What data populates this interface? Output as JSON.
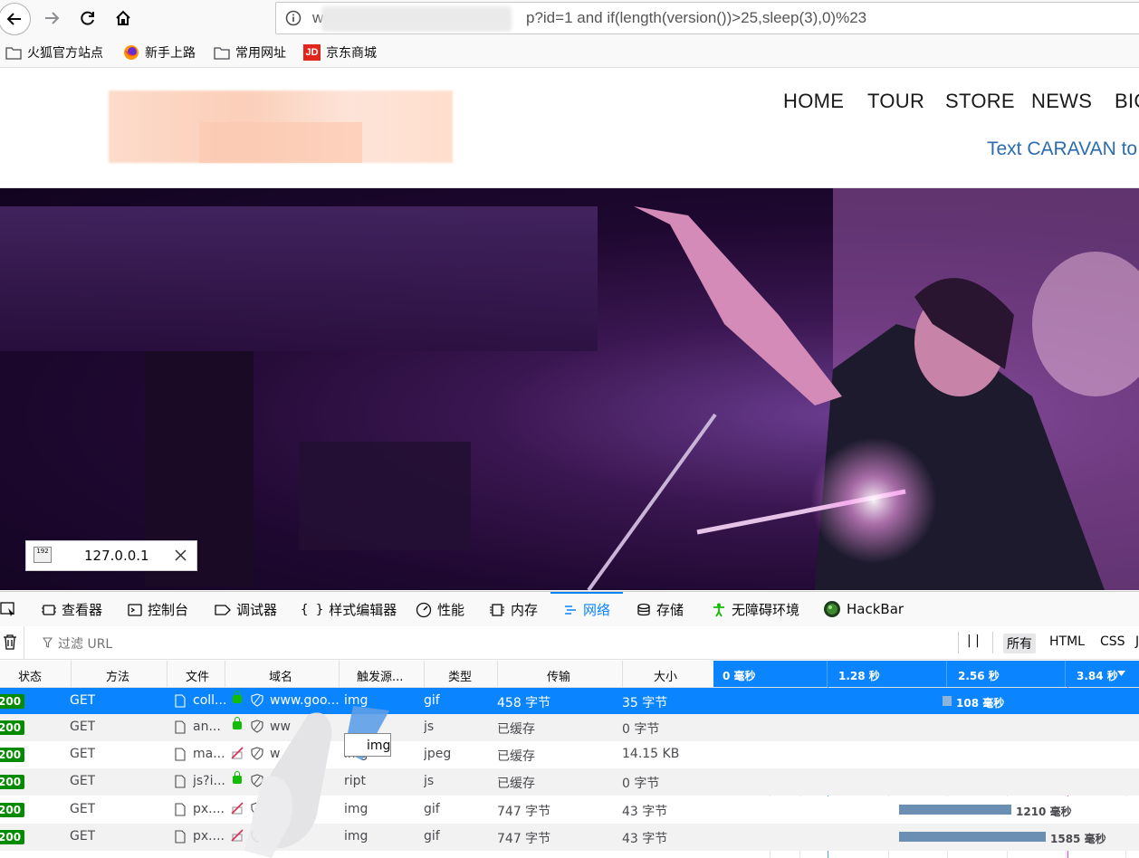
{
  "browser": {
    "url_visible": "p?id=1 and if(length(version())>25,sleep(3),0)%23",
    "url_prefix": "w",
    "bookmarks": [
      {
        "label": "火狐官方站点",
        "icon": "folder-icon"
      },
      {
        "label": "新手上路",
        "icon": "firefox-icon"
      },
      {
        "label": "常用网址",
        "icon": "folder-icon"
      },
      {
        "label": "京东商城",
        "icon": "jd-icon"
      }
    ],
    "jd_badge": "JD"
  },
  "site": {
    "menu": [
      "HOME",
      "TOUR",
      "STORE",
      "NEWS",
      "BIG"
    ],
    "caravan_text": "Text CARAVAN to"
  },
  "ip_popup": {
    "ip": "127.0.0.1",
    "icon_text": "192"
  },
  "devtools": {
    "tabs": [
      {
        "label": "查看器",
        "icon": "inspector-icon"
      },
      {
        "label": "控制台",
        "icon": "console-icon"
      },
      {
        "label": "调试器",
        "icon": "debugger-icon"
      },
      {
        "label": "样式编辑器",
        "icon": "style-editor-icon"
      },
      {
        "label": "性能",
        "icon": "performance-icon"
      },
      {
        "label": "内存",
        "icon": "memory-icon"
      },
      {
        "label": "网络",
        "icon": "network-icon",
        "active": true
      },
      {
        "label": "存储",
        "icon": "storage-icon"
      },
      {
        "label": "无障碍环境",
        "icon": "accessibility-icon"
      },
      {
        "label": "HackBar",
        "icon": "hackbar-icon"
      }
    ],
    "style_editor_braces": "{ }",
    "filter_placeholder": "过滤 URL",
    "pause_glyph": "| |",
    "type_filters": [
      {
        "label": "所有",
        "selected": true
      },
      {
        "label": "HTML"
      },
      {
        "label": "CSS"
      },
      {
        "label": "J"
      }
    ],
    "columns": [
      "状态",
      "方法",
      "文件",
      "域名",
      "触发源...",
      "类型",
      "传输",
      "大小"
    ],
    "timeline_ticks": [
      "0 毫秒",
      "1.28 秒",
      "2.56 秒",
      "3.84 秒"
    ],
    "tooltip": "img",
    "requests": [
      {
        "status": "200",
        "method": "GET",
        "file": "coll...",
        "domain": "www.goo...",
        "cause": "img",
        "type": "gif",
        "transferred": "458 字节",
        "size": "35 字节",
        "timing": "108 毫秒",
        "secure": true
      },
      {
        "status": "200",
        "method": "GET",
        "file": "an...",
        "domain": "ww",
        "cause": "",
        "type": "js",
        "transferred": "已缓存",
        "size": "0 字节",
        "timing": "",
        "secure": true
      },
      {
        "status": "200",
        "method": "GET",
        "file": "ma...",
        "domain": "w",
        "cause": "img",
        "type": "jpeg",
        "transferred": "已缓存",
        "size": "14.15 KB",
        "timing": "",
        "secure": false
      },
      {
        "status": "200",
        "method": "GET",
        "file": "js?i...",
        "domain": "",
        "cause": "ript",
        "type": "js",
        "transferred": "已缓存",
        "size": "0 字节",
        "timing": "",
        "secure": true
      },
      {
        "status": "200",
        "method": "GET",
        "file": "px....",
        "domain": "",
        "cause": "img",
        "type": "gif",
        "transferred": "747 字节",
        "size": "43 字节",
        "timing": "1210 毫秒",
        "secure": false
      },
      {
        "status": "200",
        "method": "GET",
        "file": "px....",
        "domain": "",
        "cause": "img",
        "type": "gif",
        "transferred": "747 字节",
        "size": "43 字节",
        "timing": "1585 毫秒",
        "secure": false
      }
    ]
  }
}
